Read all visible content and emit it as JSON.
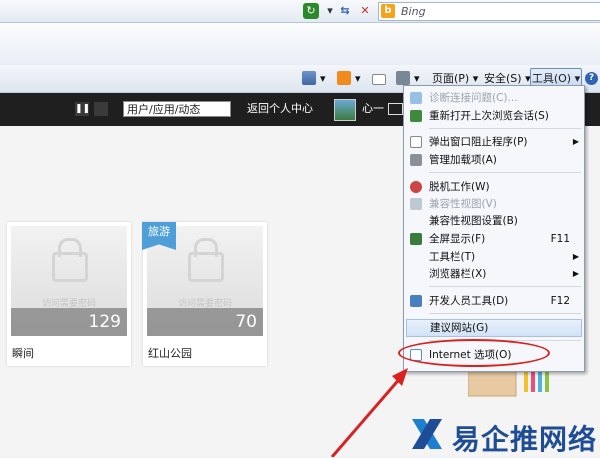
{
  "addressbar": {
    "search_placeholder": "Bing",
    "refresh_icon": "refresh-icon",
    "stop_icon": "stop-icon"
  },
  "commandbar": {
    "home_icon": "home-icon",
    "feeds_icon": "rss-icon",
    "mail_icon": "mail-icon",
    "print_icon": "print-icon",
    "page_label": "页面(P)",
    "safety_label": "安全(S)",
    "tools_label": "工具(O)",
    "help_icon": "help-icon"
  },
  "site_header": {
    "search_value": "用户/应用/动态",
    "return_link": "返回个人中心",
    "user_name": "心一"
  },
  "cards": [
    {
      "name": "瞬间",
      "locked_text": "访问需要密码",
      "count": "129",
      "tag": ""
    },
    {
      "name": "红山公园",
      "locked_text": "访问需要密码",
      "count": "70",
      "tag": "旅游"
    }
  ],
  "tools_menu": {
    "items": [
      {
        "label": "诊断连接问题(C)...",
        "disabled": true,
        "shortcut": "",
        "submenu": false,
        "icon": "diagnose-icon"
      },
      {
        "label": "重新打开上次浏览会话(S)",
        "disabled": false,
        "shortcut": "",
        "submenu": false,
        "icon": "reopen-session-icon"
      },
      {
        "label": "弹出窗口阻止程序(P)",
        "disabled": false,
        "shortcut": "",
        "submenu": true,
        "icon": "popup-blocker-icon"
      },
      {
        "label": "管理加载项(A)",
        "disabled": false,
        "shortcut": "",
        "submenu": false,
        "icon": "addons-icon"
      },
      {
        "label": "脱机工作(W)",
        "disabled": false,
        "shortcut": "",
        "submenu": false,
        "icon": "offline-icon"
      },
      {
        "label": "兼容性视图(V)",
        "disabled": true,
        "shortcut": "",
        "submenu": false,
        "icon": "compat-view-icon"
      },
      {
        "label": "兼容性视图设置(B)",
        "disabled": false,
        "shortcut": "",
        "submenu": false,
        "icon": ""
      },
      {
        "label": "全屏显示(F)",
        "disabled": false,
        "shortcut": "F11",
        "submenu": false,
        "icon": "fullscreen-icon"
      },
      {
        "label": "工具栏(T)",
        "disabled": false,
        "shortcut": "",
        "submenu": true,
        "icon": ""
      },
      {
        "label": "浏览器栏(X)",
        "disabled": false,
        "shortcut": "",
        "submenu": true,
        "icon": ""
      },
      {
        "label": "开发人员工具(D)",
        "disabled": false,
        "shortcut": "F12",
        "submenu": false,
        "icon": "dev-tools-icon"
      },
      {
        "label": "建议网站(G)",
        "disabled": false,
        "shortcut": "",
        "submenu": false,
        "icon": ""
      },
      {
        "label": "Internet 选项(O)",
        "disabled": false,
        "shortcut": "",
        "submenu": false,
        "icon": "internet-options-icon"
      }
    ]
  },
  "watermark": {
    "text": "易企推网络"
  },
  "colors": {
    "annotation_red": "#d9221f",
    "site_header": "#1f1f1f",
    "menu_bg": "#f5f7fb"
  }
}
